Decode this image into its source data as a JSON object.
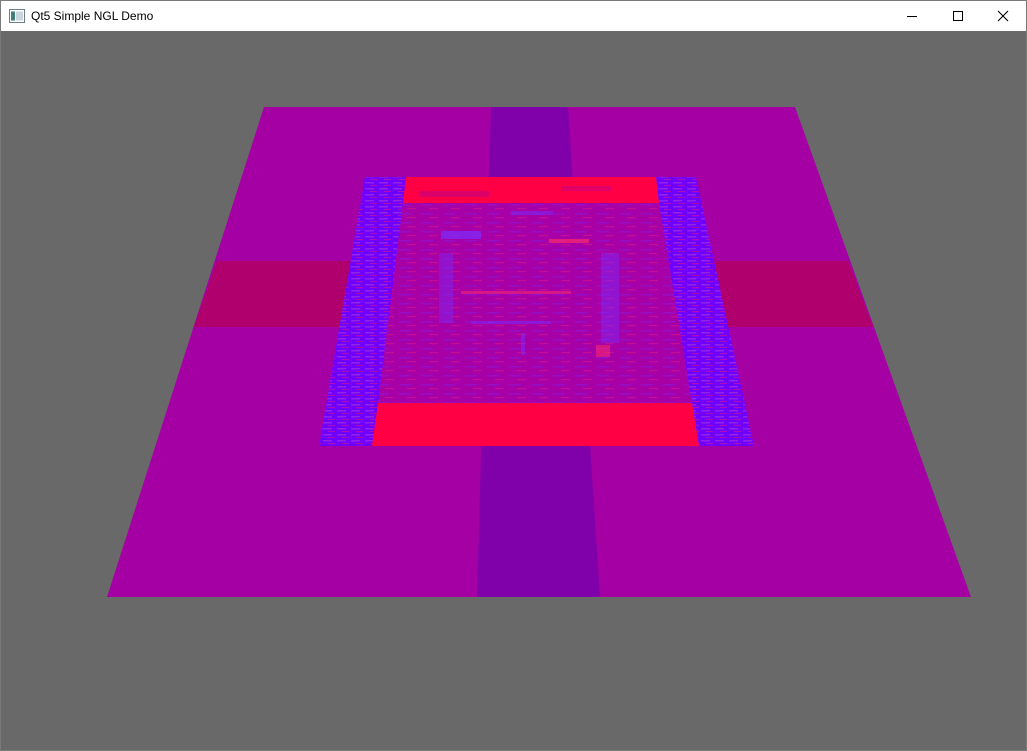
{
  "window": {
    "title": "Qt5 Simple NGL Demo",
    "icon": "app-window-icon"
  },
  "controls": {
    "minimize_icon": "minimize-icon",
    "maximize_icon": "maximize-icon",
    "close_icon": "close-icon"
  },
  "scene": {
    "background_color": "#696969",
    "plane_color": "#a400a4",
    "stripe_dark_color": "#8000aa",
    "stripe_crimson_color": "#b0006e",
    "frame_blue_color": "#6f00ff",
    "frame_red_color": "#ff0044",
    "inner_color": "#a600a6"
  }
}
